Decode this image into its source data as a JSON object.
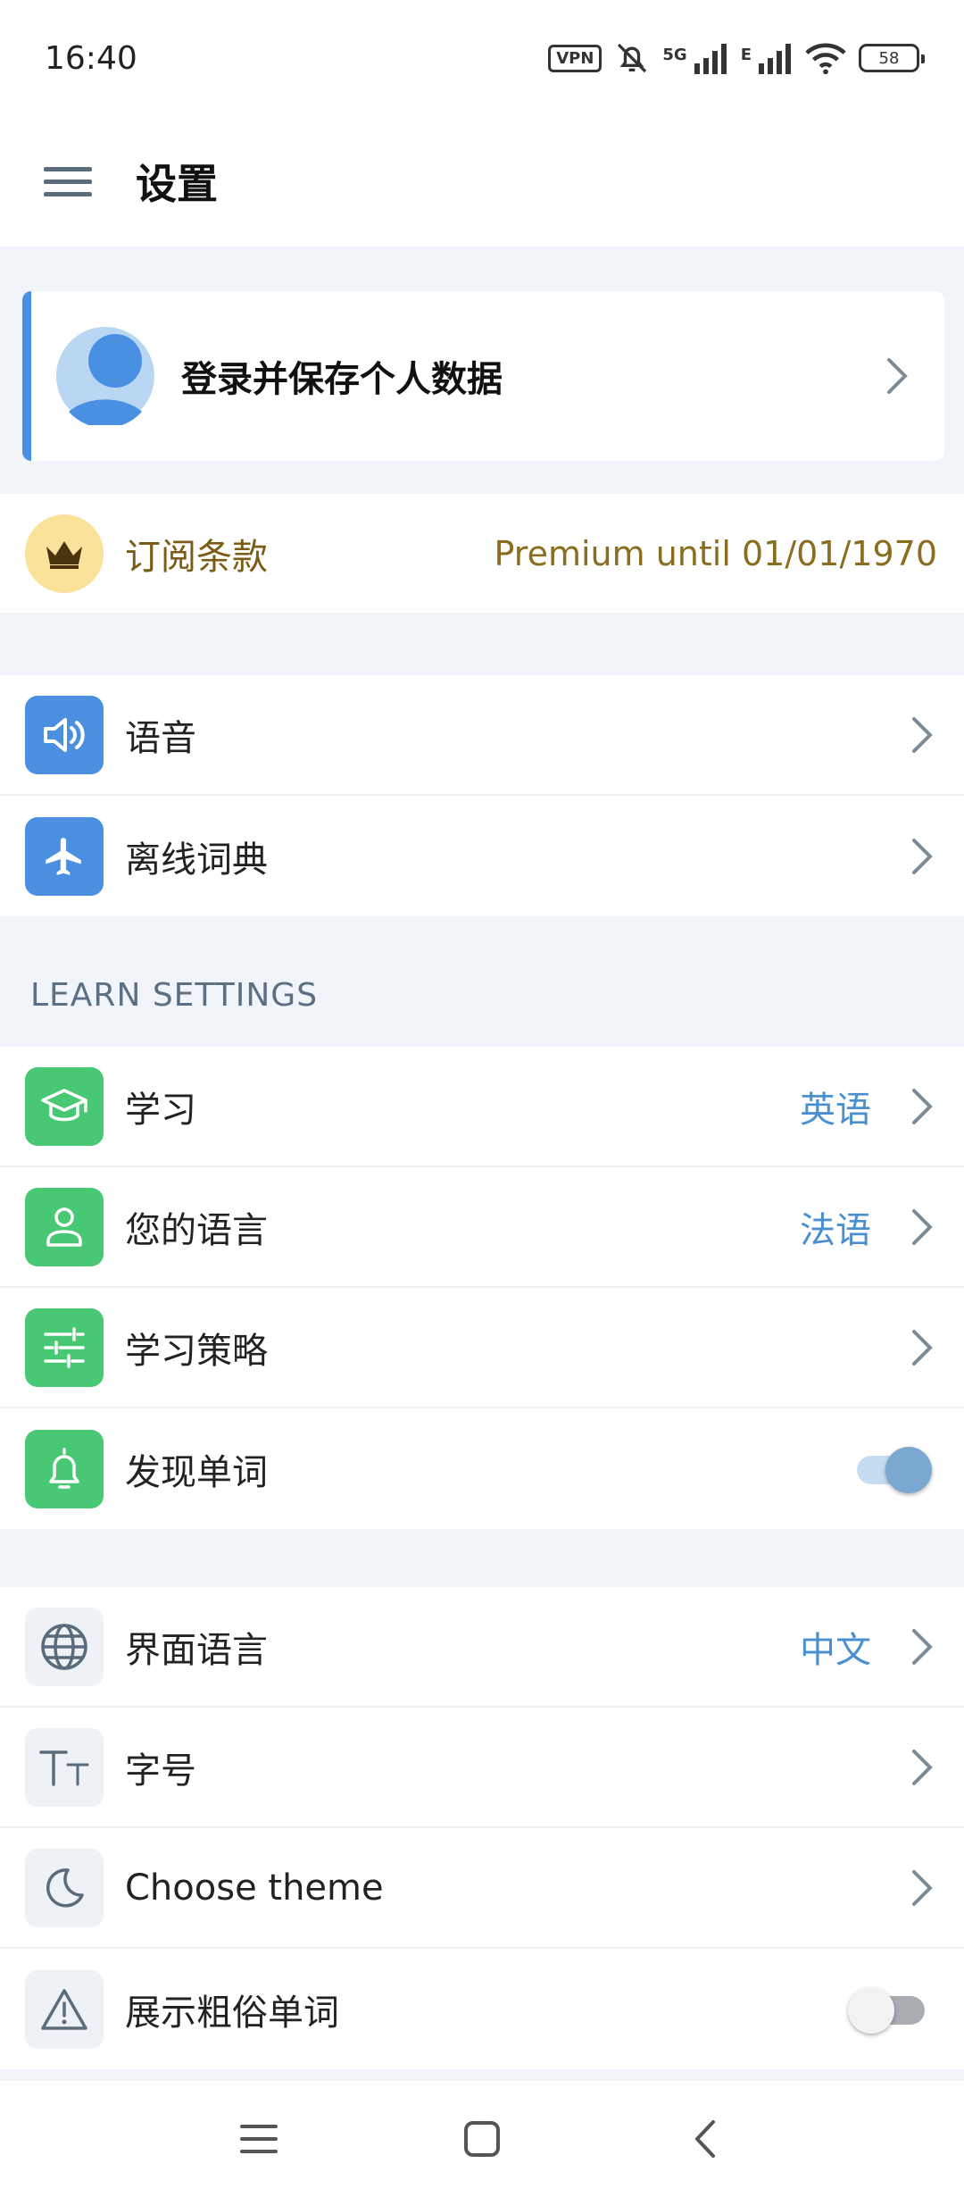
{
  "status": {
    "time": "16:40",
    "vpn": "VPN",
    "net_1": "5G",
    "net_2": "E",
    "battery": "58"
  },
  "header": {
    "title": "设置"
  },
  "login": {
    "text": "登录并保存个人数据"
  },
  "subscription": {
    "label": "订阅条款",
    "value": "Premium until 01/01/1970"
  },
  "general": [
    {
      "label": "语音",
      "icon": "speaker-icon"
    },
    {
      "label": "离线词典",
      "icon": "airplane-icon"
    }
  ],
  "learn_section": {
    "title": "LEARN SETTINGS",
    "items": [
      {
        "label": "学习",
        "value": "英语",
        "icon": "graduation-cap-icon"
      },
      {
        "label": "您的语言",
        "value": "法语",
        "icon": "person-icon"
      },
      {
        "label": "学习策略",
        "icon": "sliders-icon"
      },
      {
        "label": "发现单词",
        "icon": "bell-icon",
        "toggle": true
      }
    ]
  },
  "app_settings": [
    {
      "label": "界面语言",
      "value": "中文",
      "icon": "globe-icon"
    },
    {
      "label": "字号",
      "icon": "font-size-icon"
    },
    {
      "label": "Choose theme",
      "icon": "moon-icon"
    },
    {
      "label": "展示粗俗单词",
      "icon": "warning-icon",
      "toggle": false
    }
  ],
  "colors": {
    "accent_blue": "#4a8fe0",
    "green": "#48c774",
    "gold": "#fbe29a"
  }
}
